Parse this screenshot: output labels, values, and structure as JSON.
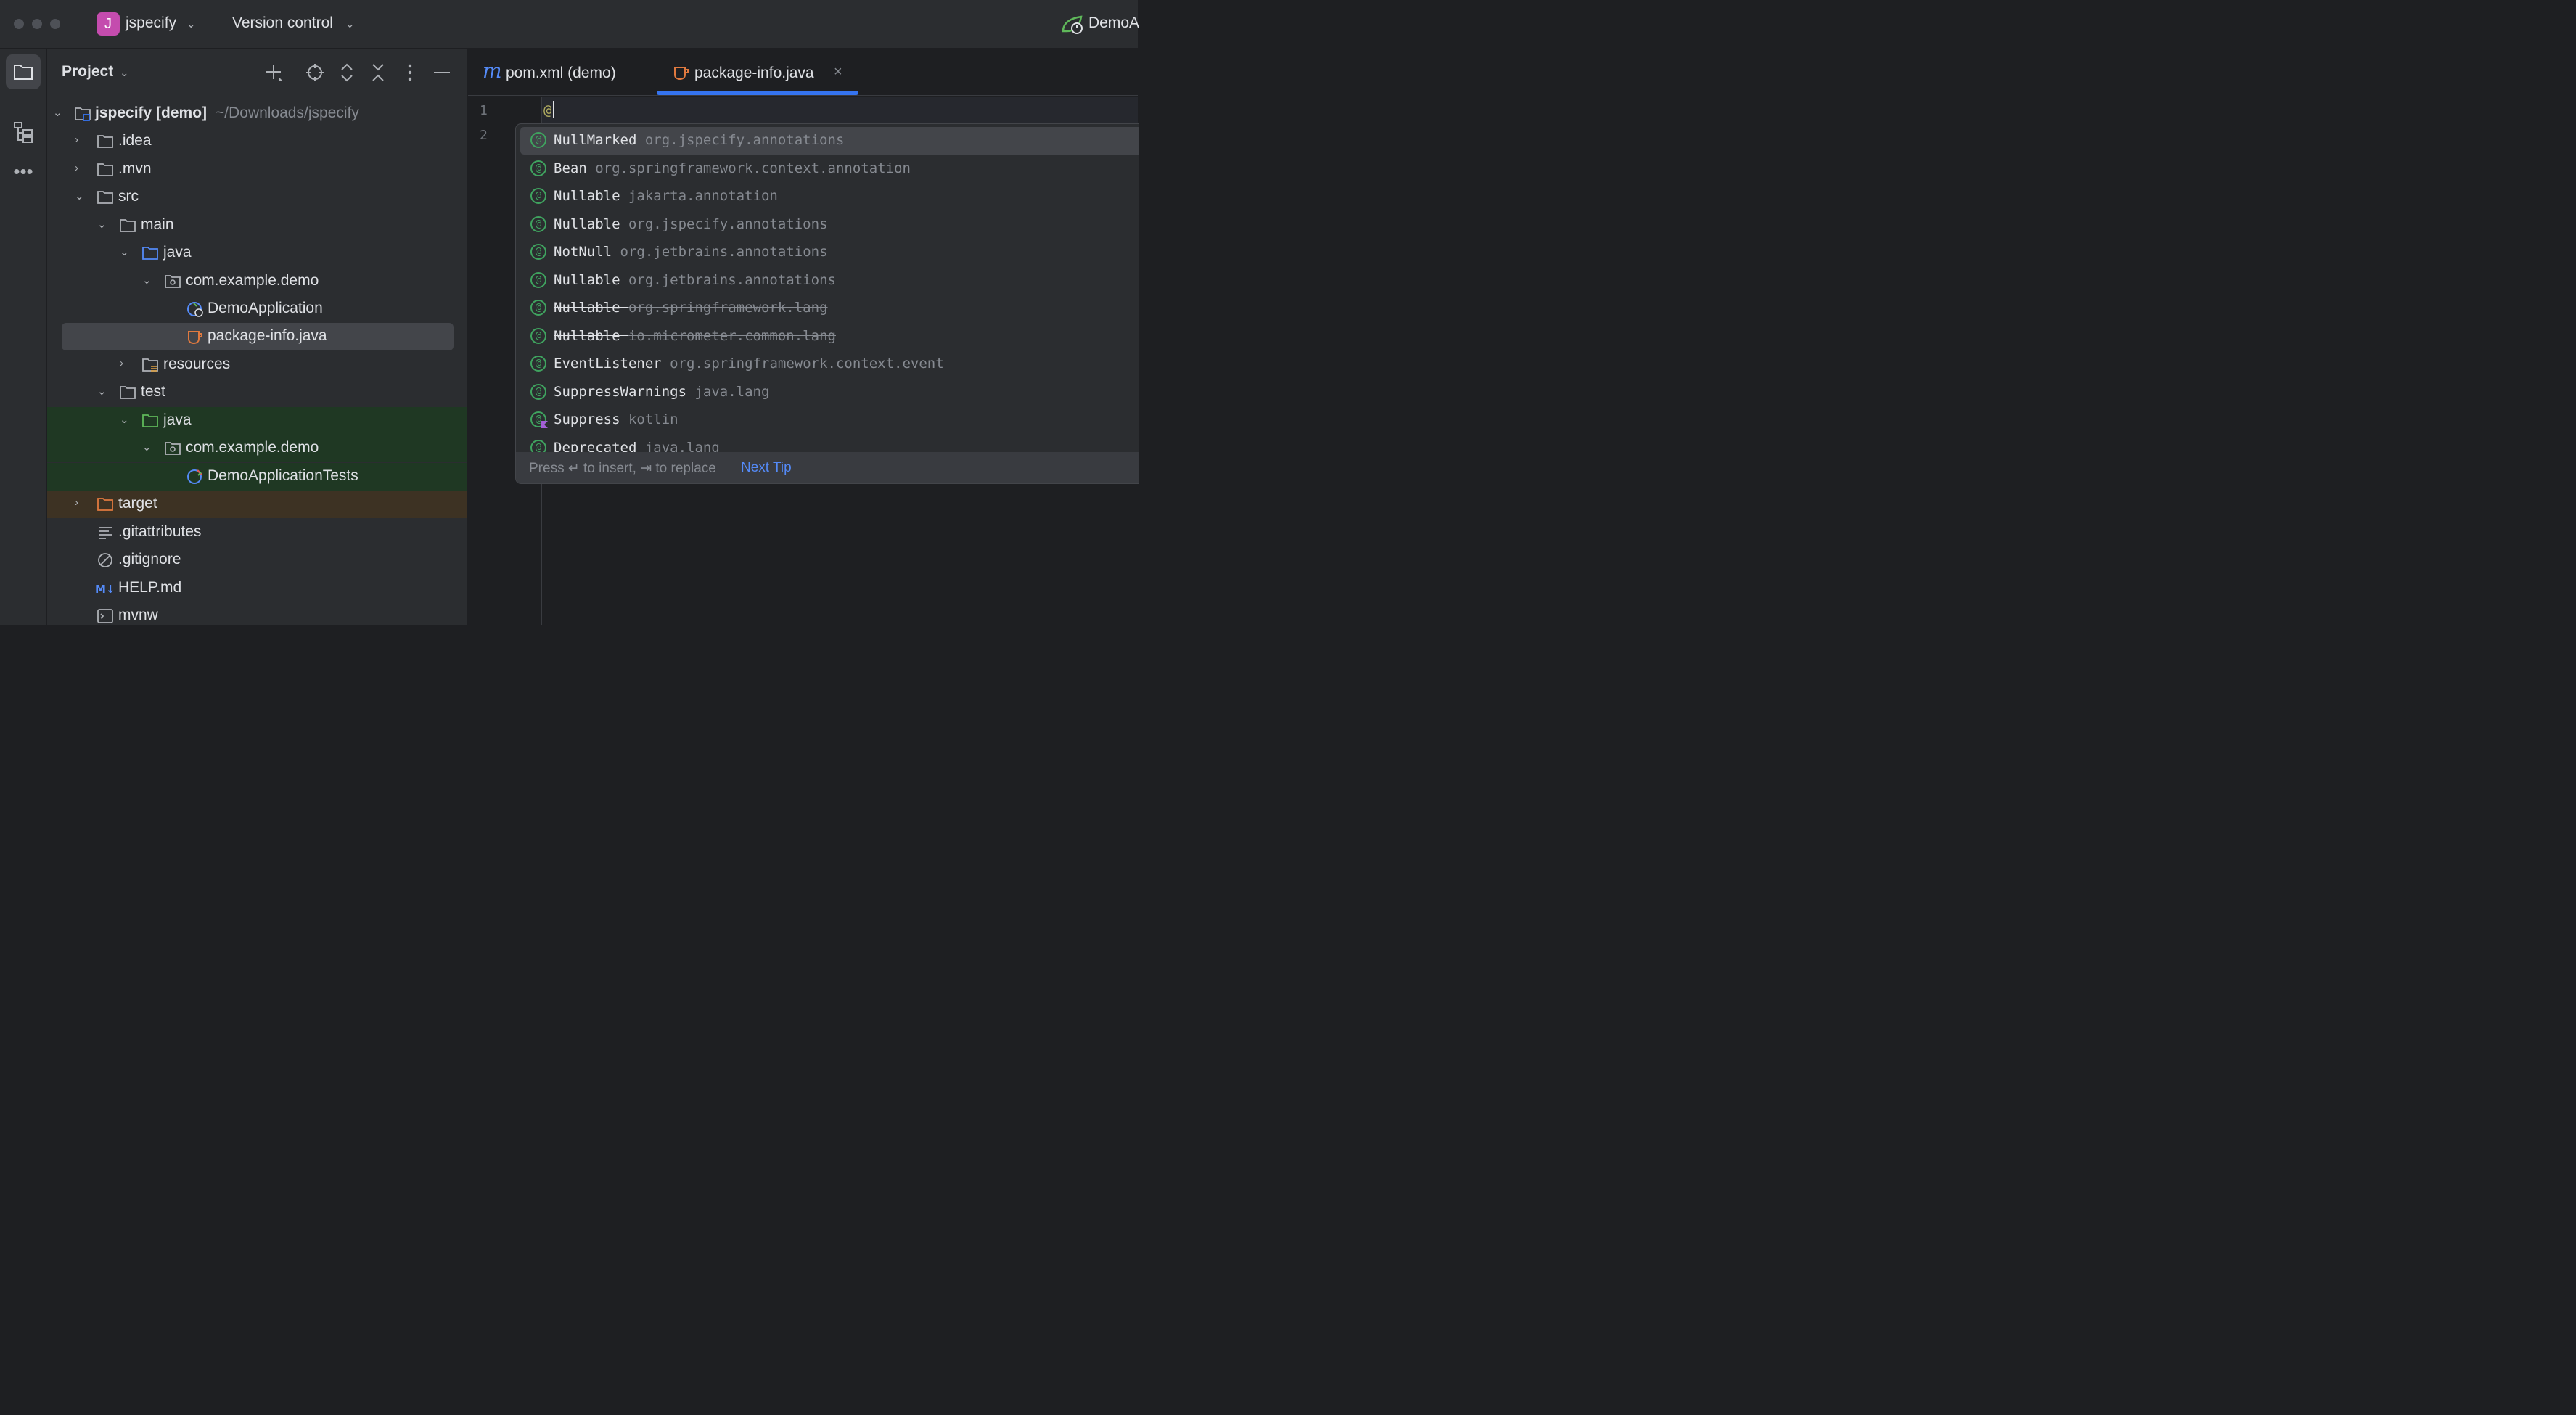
{
  "titlebar": {
    "project_badge": "J",
    "project_name": "jspecify",
    "vcs_label": "Version control",
    "run_config": "DemoA"
  },
  "project_panel": {
    "title": "Project",
    "tree": [
      {
        "label": "jspecify [demo]",
        "suffix": "~/Downloads/jspecify",
        "icon": "module-folder-icon",
        "expanded": true
      },
      {
        "label": ".idea",
        "icon": "folder-icon",
        "expanded": false
      },
      {
        "label": ".mvn",
        "icon": "folder-icon",
        "expanded": false
      },
      {
        "label": "src",
        "icon": "folder-icon",
        "expanded": true
      },
      {
        "label": "main",
        "icon": "folder-icon",
        "expanded": true
      },
      {
        "label": "java",
        "icon": "source-folder-icon",
        "expanded": true
      },
      {
        "label": "com.example.demo",
        "icon": "package-icon",
        "expanded": true
      },
      {
        "label": "DemoApplication",
        "icon": "spring-class-icon"
      },
      {
        "label": "package-info.java",
        "icon": "java-file-icon",
        "selected": true
      },
      {
        "label": "resources",
        "icon": "resources-folder-icon",
        "expanded": false
      },
      {
        "label": "test",
        "icon": "folder-icon",
        "expanded": true
      },
      {
        "label": "java",
        "icon": "test-folder-icon",
        "expanded": true
      },
      {
        "label": "com.example.demo",
        "icon": "package-icon",
        "expanded": true
      },
      {
        "label": "DemoApplicationTests",
        "icon": "test-class-icon"
      },
      {
        "label": "target",
        "icon": "excluded-folder-icon",
        "expanded": false
      },
      {
        "label": ".gitattributes",
        "icon": "text-file-icon"
      },
      {
        "label": ".gitignore",
        "icon": "ignore-file-icon"
      },
      {
        "label": "HELP.md",
        "icon": "markdown-icon"
      },
      {
        "label": "mvnw",
        "icon": "shell-script-icon"
      }
    ]
  },
  "editor": {
    "tabs": [
      {
        "label": "pom.xml (demo)",
        "icon": "maven-icon",
        "active": false
      },
      {
        "label": "package-info.java",
        "icon": "java-file-icon",
        "active": true
      }
    ],
    "line_numbers": [
      "1",
      "2"
    ],
    "line1_text": "@"
  },
  "completion": {
    "items": [
      {
        "name": "NullMarked",
        "package": "org.jspecify.annotations",
        "selected": true,
        "deprecated": false
      },
      {
        "name": "Bean",
        "package": "org.springframework.context.annotation",
        "deprecated": false
      },
      {
        "name": "Nullable",
        "package": "jakarta.annotation",
        "deprecated": false
      },
      {
        "name": "Nullable",
        "package": "org.jspecify.annotations",
        "deprecated": false
      },
      {
        "name": "NotNull",
        "package": "org.jetbrains.annotations",
        "deprecated": false
      },
      {
        "name": "Nullable",
        "package": "org.jetbrains.annotations",
        "deprecated": false
      },
      {
        "name": "Nullable",
        "package": "org.springframework.lang",
        "deprecated": true
      },
      {
        "name": "Nullable",
        "package": "io.micrometer.common.lang",
        "deprecated": true
      },
      {
        "name": "EventListener",
        "package": "org.springframework.context.event",
        "deprecated": false
      },
      {
        "name": "SuppressWarnings",
        "package": "java.lang",
        "deprecated": false
      },
      {
        "name": "Suppress",
        "package": "kotlin",
        "deprecated": false,
        "kotlin": true
      },
      {
        "name": "Deprecated",
        "package": "java.lang",
        "deprecated": false,
        "partial": true
      }
    ],
    "hint_text": "Press ↵ to insert, ⇥ to replace",
    "next_tip": "Next Tip"
  },
  "colors": {
    "accent_blue": "#3574f0",
    "selected_row": "#43454a",
    "test_bg": "#1f3823",
    "excluded_bg": "#3d3223",
    "annotation_green": "#3fa35f"
  }
}
